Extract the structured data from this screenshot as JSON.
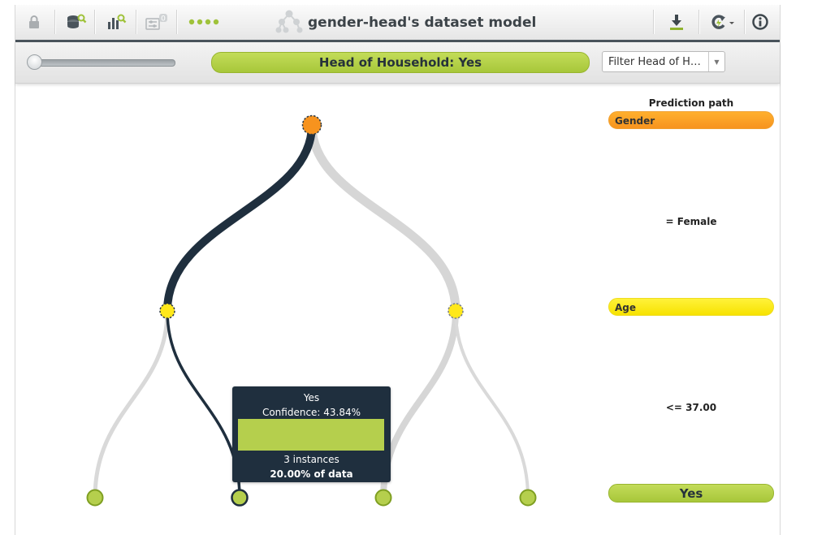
{
  "toolbar": {
    "title": "gender-head's dataset model",
    "icons": [
      "lock-icon",
      "dataset-search-icon",
      "chart-search-icon",
      "filter-settings-icon",
      "more-dots-icon",
      "model-tree-icon",
      "download-icon",
      "refresh-icon",
      "info-icon"
    ],
    "filter_count": "0"
  },
  "subbar": {
    "prediction_label": "Head of Household: Yes",
    "filter_select_value": "Filter Head of Ho..."
  },
  "tooltip": {
    "prediction": "Yes",
    "confidence": "Confidence: 43.84%",
    "instances": "3 instances",
    "data_share": "20.00% of data",
    "confidence_value": 43.84
  },
  "prediction_path": {
    "title": "Prediction path",
    "first_field": "Gender",
    "first_condition": "= Female",
    "second_field": "Age",
    "second_condition": "<= 37.00",
    "outcome": "Yes"
  },
  "colors": {
    "accent_green": "#b5cf4d",
    "orange_node": "#f7931e",
    "yellow_node": "#f7e200",
    "path_dark": "#1f2f3e",
    "branch_gray": "#d6d6d6"
  }
}
